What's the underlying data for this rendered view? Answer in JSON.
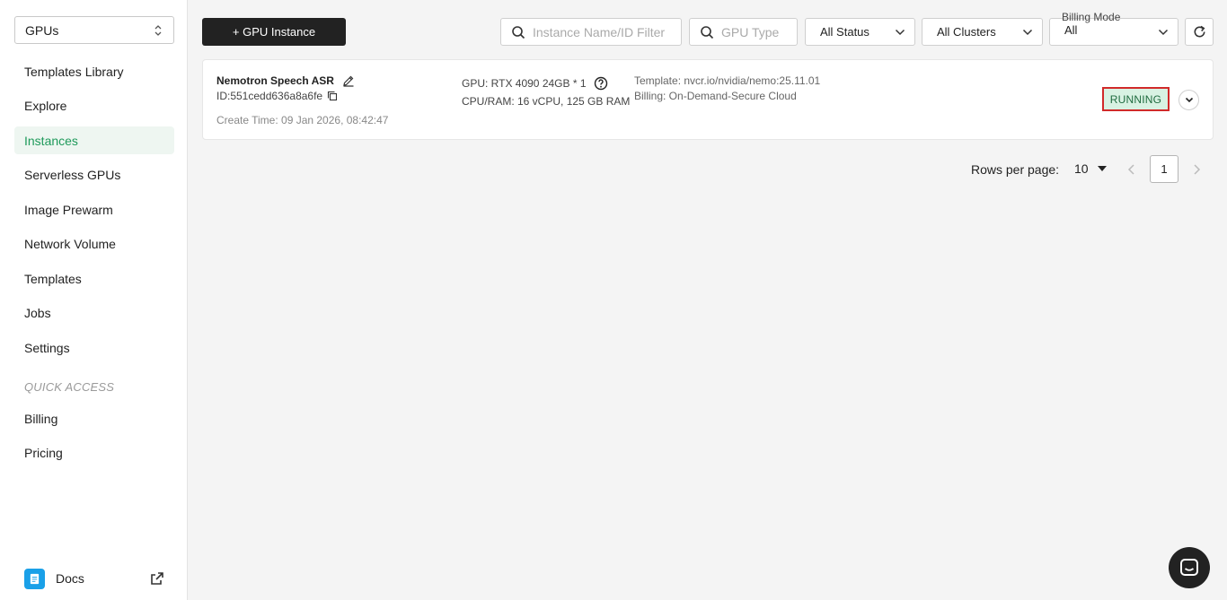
{
  "sidebar": {
    "selector_value": "GPUs",
    "items": [
      {
        "label": "Templates Library"
      },
      {
        "label": "Explore"
      },
      {
        "label": "Instances",
        "active": true
      },
      {
        "label": "Serverless GPUs"
      },
      {
        "label": "Image Prewarm"
      },
      {
        "label": "Network Volume"
      },
      {
        "label": "Templates"
      },
      {
        "label": "Jobs"
      },
      {
        "label": "Settings"
      }
    ],
    "quick_access_title": "QUICK ACCESS",
    "quick_items": [
      {
        "label": "Billing"
      },
      {
        "label": "Pricing"
      }
    ],
    "docs_label": "Docs"
  },
  "toolbar": {
    "new_button": "+ GPU Instance",
    "name_filter_placeholder": "Instance Name/ID Filter",
    "gpu_type_placeholder": "GPU Type",
    "status_value": "All Status",
    "clusters_value": "All Clusters",
    "billing_mode_label": "Billing Mode",
    "billing_mode_value": "All"
  },
  "instance": {
    "name": "Nemotron Speech ASR",
    "id": "ID:551cedd636a8a6fe",
    "create_time": "Create Time: 09 Jan 2026, 08:42:47",
    "gpu": "GPU: RTX 4090 24GB * 1",
    "cpu_ram": "CPU/RAM: 16 vCPU, 125 GB RAM",
    "template": "Template: nvcr.io/nvidia/nemo:25.11.01",
    "billing": "Billing: On-Demand-Secure Cloud",
    "status": "RUNNING"
  },
  "pagination": {
    "rows_label": "Rows per page:",
    "rows_value": "10",
    "current_page": "1"
  },
  "colors": {
    "accent_green": "#1f9a5b",
    "status_bg": "#d8f2e3",
    "highlight_red": "#d12a2a",
    "dark_button": "#222222"
  }
}
